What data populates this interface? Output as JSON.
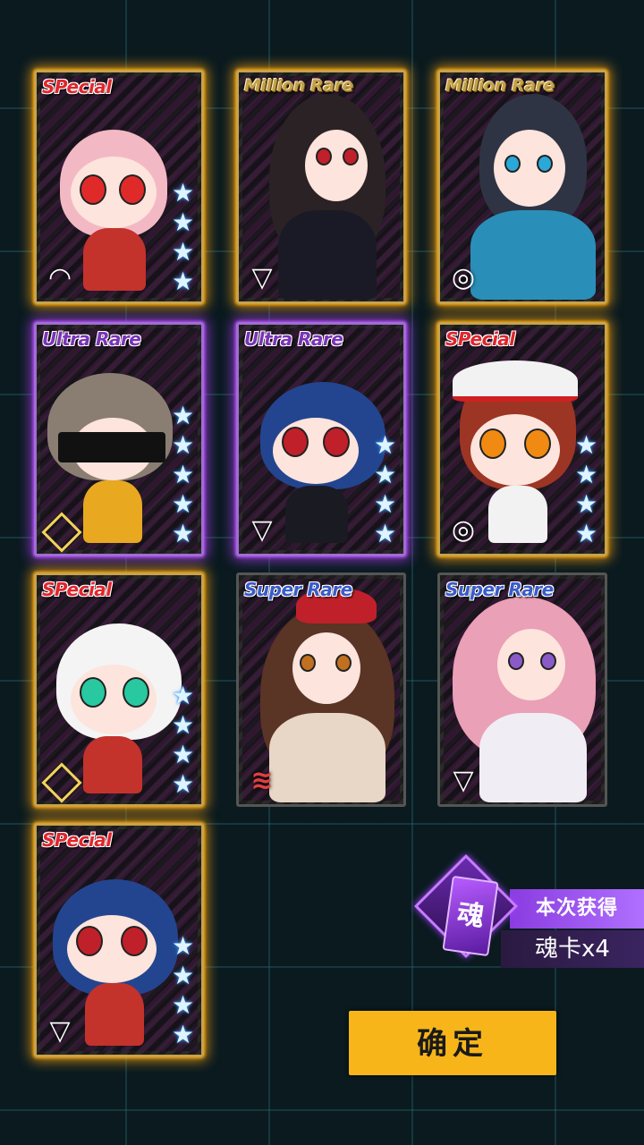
{
  "cards": [
    {
      "rarity": "SPecial",
      "stars": "★★★★",
      "emblem": "wifi"
    },
    {
      "rarity": "Million Rare",
      "stars": "",
      "emblem": "triangle"
    },
    {
      "rarity": "Million Rare",
      "stars": "",
      "emblem": "circle"
    },
    {
      "rarity": "Ultra Rare",
      "stars": "★★★★★",
      "emblem": "diamond"
    },
    {
      "rarity": "Ultra Rare",
      "stars": "★★★★",
      "emblem": "triangle"
    },
    {
      "rarity": "SPecial",
      "stars": "★★★★",
      "emblem": "circle"
    },
    {
      "rarity": "SPecial",
      "stars": "★★★★",
      "emblem": "diamond"
    },
    {
      "rarity": "Super Rare",
      "stars": "",
      "emblem": "lines"
    },
    {
      "rarity": "Super Rare",
      "stars": "",
      "emblem": "triangle"
    },
    {
      "rarity": "SPecial",
      "stars": "★★★★",
      "emblem": "triangle"
    }
  ],
  "soul": {
    "icon_char": "魂",
    "obtained_label": "本次获得",
    "count_label": "魂卡x4"
  },
  "confirm_label": "确定",
  "colors": {
    "gold_glow": "#f5a014",
    "purple_glow": "#aa3cf0",
    "button": "#f7b51a"
  }
}
